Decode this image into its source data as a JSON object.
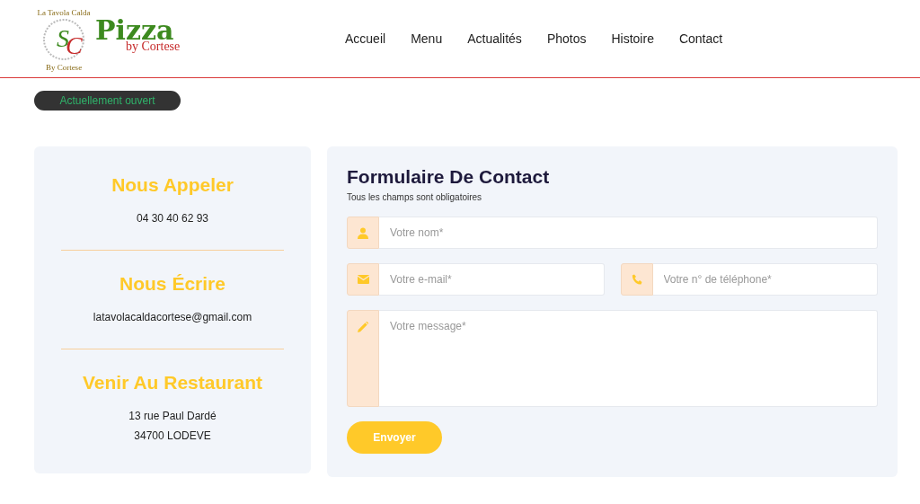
{
  "logo": {
    "ring_top": "La Tavola Calda",
    "ring_bottom": "By Cortese",
    "monogram": "SC",
    "title": "Pizza",
    "subtitle": "by Cortese"
  },
  "nav": [
    {
      "label": "Accueil"
    },
    {
      "label": "Menu"
    },
    {
      "label": "Actualités"
    },
    {
      "label": "Photos"
    },
    {
      "label": "Histoire"
    },
    {
      "label": "Contact"
    }
  ],
  "status": {
    "label": "Actuellement ouvert",
    "open": true
  },
  "contact_info": [
    {
      "title": "Nous Appeler",
      "lines": [
        "04 30 40 62 93"
      ]
    },
    {
      "title": "Nous Écrire",
      "lines": [
        "latavolacaldacortese@gmail.com"
      ]
    },
    {
      "title": "Venir Au Restaurant",
      "lines": [
        "13 rue Paul Dardé",
        "34700 LODEVE"
      ]
    }
  ],
  "form": {
    "title": "Formulaire De Contact",
    "subtitle": "Tous les champs sont obligatoires",
    "fields": [
      {
        "kind": "name",
        "placeholder": "Votre nom*"
      },
      {
        "kind": "email",
        "placeholder": "Votre e-mail*"
      },
      {
        "kind": "phone",
        "placeholder": "Votre n° de téléphone*"
      },
      {
        "kind": "message",
        "placeholder": "Votre message*"
      }
    ],
    "submit": "Envoyer"
  }
}
